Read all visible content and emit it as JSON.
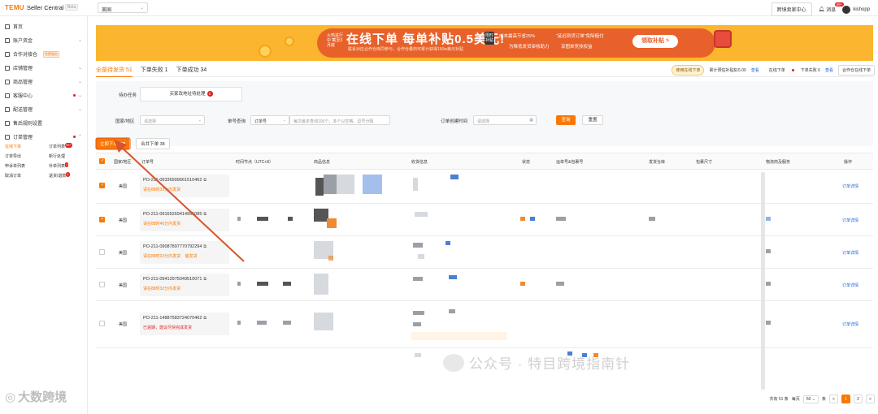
{
  "topbar": {
    "logo": "TEMU",
    "product": "Seller Central",
    "beta": "Beta",
    "region_value": "美国",
    "cross_border_button": "跨境卖家中心",
    "messages_label": "消息",
    "messages_badge": "99+",
    "username": "kishopp"
  },
  "sidebar": {
    "items": [
      {
        "label": "首页",
        "icon": "home-icon"
      },
      {
        "label": "账户资金",
        "icon": "wallet-icon",
        "chevron": true
      },
      {
        "label": "合作对接仓",
        "icon": "warehouse-icon",
        "tag": "免费服务"
      },
      {
        "label": "店铺管理",
        "icon": "store-icon",
        "chevron": true
      },
      {
        "label": "商品管理",
        "icon": "product-icon",
        "chevron": true
      },
      {
        "label": "客服中心",
        "icon": "service-icon",
        "chevron": true,
        "dot": true
      },
      {
        "label": "配送管理",
        "icon": "delivery-icon",
        "chevron": true
      },
      {
        "label": "售后规则设置",
        "icon": "aftersale-icon"
      },
      {
        "label": "订单管理",
        "icon": "order-icon",
        "chevron": true,
        "dot": true
      }
    ],
    "submenu": [
      {
        "label": "在线下单",
        "active": true
      },
      {
        "label": "订单列表",
        "badge": "99+"
      },
      {
        "label": "订单导出"
      },
      {
        "label": "新行处理"
      },
      {
        "label": "申诉单列表"
      },
      {
        "label": "补单列表",
        "badge": "1"
      },
      {
        "label": "取消订单"
      },
      {
        "label": "退货/退款",
        "badge": "1"
      }
    ]
  },
  "watermark_left": "大数跨境",
  "banner": {
    "mini": "火热进行中 截至3月底",
    "title": "在线下单 每单补贴0.5美元!",
    "subtitle": "联系对应合作仓库同参与，合作仓量商可累计获得150w美元补贴",
    "tag": "限时补贴",
    "features": [
      "成本最高节省25%",
      "“延迟到货订单”免除赔付",
      "为降低发货审核助力",
      "享图单竞技权益"
    ],
    "cta": "领取补贴 >"
  },
  "tabs": [
    {
      "label": "全部待发货 51",
      "active": true
    },
    {
      "label": "下单失败 1"
    },
    {
      "label": "下单成功 34"
    }
  ],
  "tabs_right": {
    "pill": "使用在线下单",
    "subsidy_text": "累计预估补贴$15.00",
    "view1": "查看",
    "online_label": "在线下单",
    "fail_text": "下单失败 6",
    "view2": "查看",
    "partner_button": "合作仓在线下单"
  },
  "filters": {
    "task_label": "待办任务",
    "task_text": "买家改地址待处理",
    "task_count": "0",
    "region_label": "国家/地区",
    "region_placeholder": "请选择",
    "number_label": "单号查询",
    "number_type": "订单号",
    "number_placeholder": "每次最多查询100个，多个以空格、逗号分隔",
    "time_label": "订单创建时间",
    "time_placeholder": "请选择",
    "search": "查询",
    "reset": "重置"
  },
  "actions": {
    "primary_label": "立即下单",
    "primary_count": "2",
    "secondary": "合并下单 38"
  },
  "table": {
    "headers": [
      "国家/地区",
      "订单号",
      "时间节点（UTC+8）",
      "商品信息",
      "收货信息",
      "状态",
      "运单号&包裹号",
      "发货仓库",
      "包裹尺寸",
      "物流商及服务",
      "操作"
    ],
    "rows": [
      {
        "checked": true,
        "region": "美国",
        "order": "PO-211-09336909661510462",
        "note": "请在88时33分内发货",
        "action": "订单详情"
      },
      {
        "checked": true,
        "region": "美国",
        "order": "PO-211-09165269414955085",
        "note": "请在88时46分内发货",
        "action": "订单详情"
      },
      {
        "checked": false,
        "region": "美国",
        "order": "PO-211-09087897770792294",
        "note": "请在88时32分内发货",
        "note2": "催发货",
        "action": "订单详情"
      },
      {
        "checked": false,
        "region": "美国",
        "order": "PO-211-09412975049510071",
        "note": "请在88时32分内发货",
        "action": "订单详情"
      },
      {
        "checked": false,
        "region": "美国",
        "order": "PO-211-14887583724070462",
        "note": "已逾期，建议尽快完成发货",
        "action": "订单详情"
      }
    ]
  },
  "pagination": {
    "total": "共有 51 条",
    "per_label": "每页",
    "per_value": "50",
    "unit": "条",
    "prev": "<",
    "pages": [
      "1",
      "2"
    ],
    "next": ">"
  },
  "watermark_right": "公众号 · 特目跨境指南针",
  "colors": {
    "accent": "#fb7701",
    "link": "#1a62d4",
    "danger": "#e02020",
    "banner": "#fbb52f",
    "arrow": "#d9542a"
  }
}
